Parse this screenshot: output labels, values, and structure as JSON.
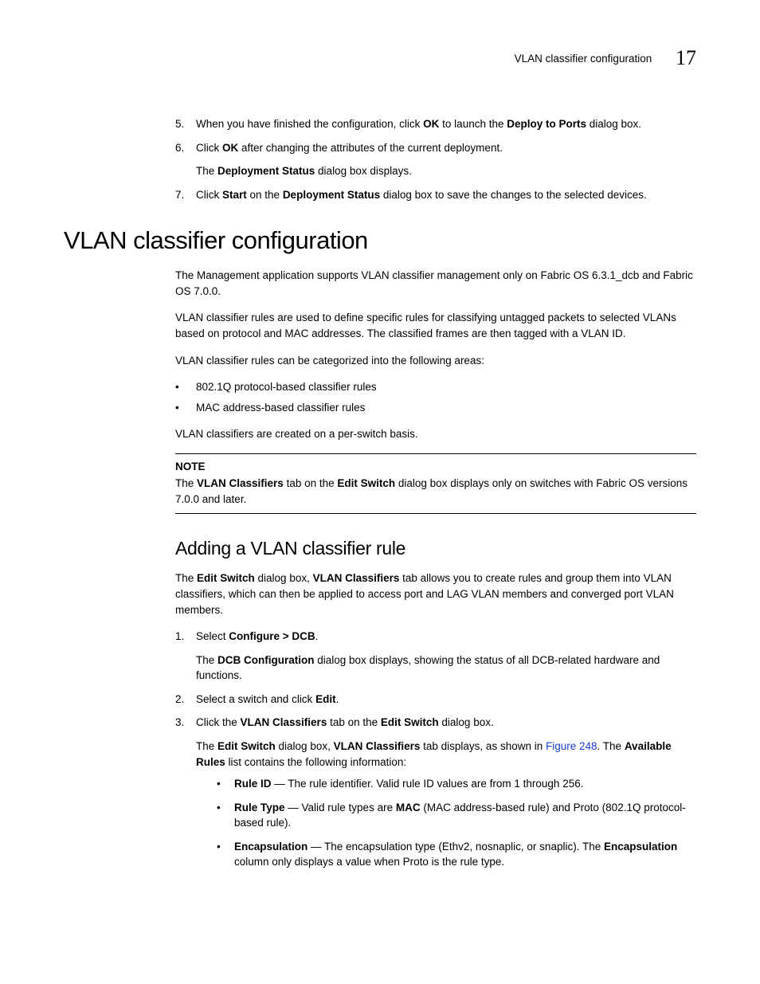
{
  "header": {
    "running_title": "VLAN classifier configuration",
    "chapter_number": "17"
  },
  "steps_top": {
    "items": [
      {
        "num": "5.",
        "segments": [
          {
            "t": "When you have finished the configuration, click "
          },
          {
            "t": "OK",
            "b": true
          },
          {
            "t": " to launch the "
          },
          {
            "t": "Deploy to Ports",
            "b": true
          },
          {
            "t": " dialog box."
          }
        ]
      },
      {
        "num": "6.",
        "segments": [
          {
            "t": "Click "
          },
          {
            "t": "OK",
            "b": true
          },
          {
            "t": " after changing the attributes of the current deployment."
          }
        ],
        "sub_segments": [
          {
            "t": "The "
          },
          {
            "t": "Deployment Status",
            "b": true
          },
          {
            "t": " dialog box displays."
          }
        ]
      },
      {
        "num": "7.",
        "segments": [
          {
            "t": "Click "
          },
          {
            "t": "Start",
            "b": true
          },
          {
            "t": " on the "
          },
          {
            "t": "Deployment Status",
            "b": true
          },
          {
            "t": " dialog box to save the changes to the selected devices."
          }
        ]
      }
    ]
  },
  "section_title": "VLAN classifier configuration",
  "section_body": {
    "p1": "The Management application supports VLAN classifier management only on Fabric OS 6.3.1_dcb and Fabric OS 7.0.0.",
    "p2": "VLAN classifier rules are used to define specific rules for classifying untagged packets to selected VLANs based on protocol and MAC addresses. The classified frames are then tagged with a VLAN ID.",
    "p3": "VLAN classifier rules can be categorized into the following areas:",
    "bullets": [
      "802.1Q protocol-based classifier rules",
      "MAC address-based classifier rules"
    ],
    "p4": "VLAN classifiers are created on a per-switch basis."
  },
  "note": {
    "label": "NOTE",
    "segments": [
      {
        "t": "The "
      },
      {
        "t": "VLAN Classifiers",
        "b": true
      },
      {
        "t": " tab on the "
      },
      {
        "t": "Edit Switch",
        "b": true
      },
      {
        "t": " dialog box displays only on switches with Fabric OS versions 7.0.0 and later."
      }
    ]
  },
  "subsection_title": "Adding a VLAN classifier rule",
  "subsection_intro": {
    "segments": [
      {
        "t": "The "
      },
      {
        "t": "Edit Switch",
        "b": true
      },
      {
        "t": " dialog box, "
      },
      {
        "t": "VLAN Classifiers",
        "b": true
      },
      {
        "t": " tab allows you to create rules and group them into VLAN classifiers, which can then be applied to access port and LAG VLAN members and converged port VLAN members."
      }
    ]
  },
  "steps_bottom": {
    "items": [
      {
        "num": "1.",
        "segments": [
          {
            "t": "Select "
          },
          {
            "t": "Configure > DCB",
            "b": true
          },
          {
            "t": "."
          }
        ],
        "sub_segments": [
          {
            "t": "The "
          },
          {
            "t": "DCB Configuration",
            "b": true
          },
          {
            "t": " dialog box displays, showing the status of all DCB-related hardware and functions."
          }
        ]
      },
      {
        "num": "2.",
        "segments": [
          {
            "t": "Select a switch and click "
          },
          {
            "t": "Edit",
            "b": true
          },
          {
            "t": "."
          }
        ]
      },
      {
        "num": "3.",
        "segments": [
          {
            "t": "Click the "
          },
          {
            "t": "VLAN Classifiers",
            "b": true
          },
          {
            "t": " tab on the "
          },
          {
            "t": "Edit Switch",
            "b": true
          },
          {
            "t": " dialog box."
          }
        ],
        "sub_segments": [
          {
            "t": "The "
          },
          {
            "t": "Edit Switch",
            "b": true
          },
          {
            "t": " dialog box, "
          },
          {
            "t": "VLAN Classifiers",
            "b": true
          },
          {
            "t": " tab displays, as shown in "
          },
          {
            "t": "Figure 248",
            "xref": true
          },
          {
            "t": ". The "
          },
          {
            "t": "Available Rules",
            "b": true
          },
          {
            "t": " list contains the following information:"
          }
        ],
        "sub_bullets": [
          {
            "segments": [
              {
                "t": "Rule ID",
                "b": true
              },
              {
                "t": " — The rule identifier. Valid rule ID values are from 1 through 256."
              }
            ]
          },
          {
            "segments": [
              {
                "t": "Rule Type",
                "b": true
              },
              {
                "t": " — Valid rule types are "
              },
              {
                "t": "MAC",
                "b": true
              },
              {
                "t": " (MAC address-based rule) and Proto (802.1Q protocol-based rule)."
              }
            ]
          },
          {
            "segments": [
              {
                "t": "Encapsulation",
                "b": true
              },
              {
                "t": " — The encapsulation type (Ethv2, nosnaplic, or snaplic). The "
              },
              {
                "t": "Encapsulation",
                "b": true
              },
              {
                "t": " column only displays a value when Proto is the rule type."
              }
            ]
          }
        ]
      }
    ]
  }
}
